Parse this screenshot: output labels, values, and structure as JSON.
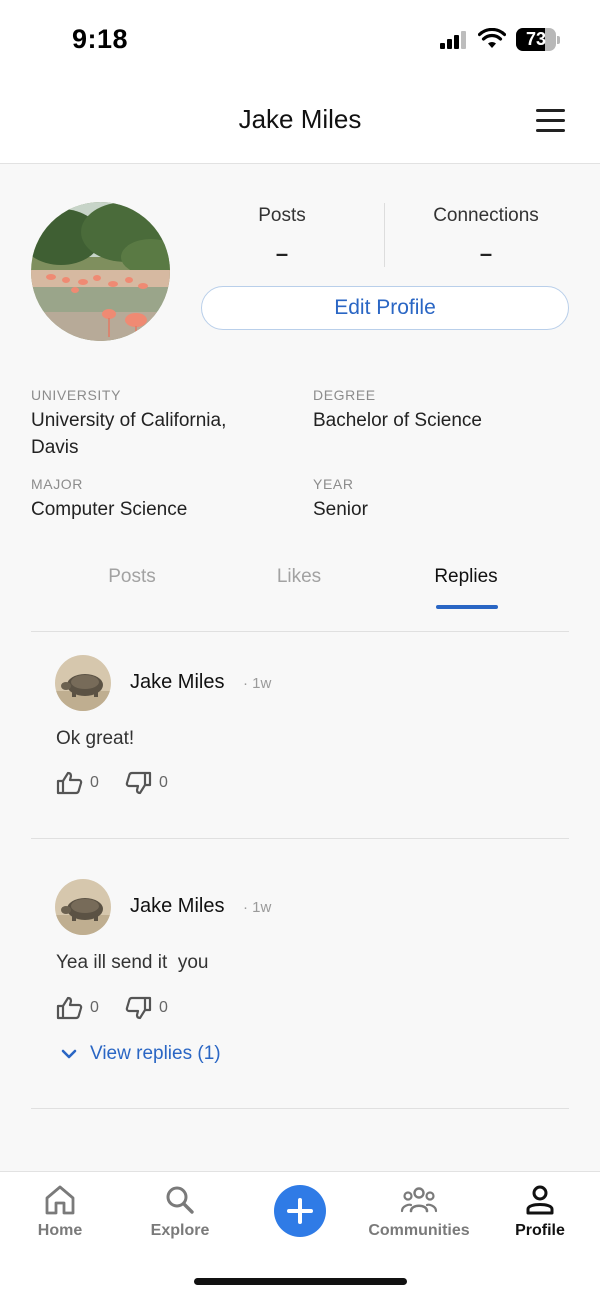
{
  "status_bar": {
    "time": "9:18",
    "battery": "73",
    "battery_level": 0.73
  },
  "header": {
    "title": "Jake Miles"
  },
  "profile": {
    "posts_label": "Posts",
    "posts_value": "–",
    "connections_label": "Connections",
    "connections_value": "–",
    "edit_button": "Edit Profile"
  },
  "info": {
    "university_label": "UNIVERSITY",
    "university_value_line1": "University of California,",
    "university_value_line2": "Davis",
    "degree_label": "DEGREE",
    "degree_value": "Bachelor of Science",
    "major_label": "MAJOR",
    "major_value": "Computer Science",
    "year_label": "YEAR",
    "year_value": "Senior"
  },
  "tabs": [
    {
      "label": "Posts",
      "active": false
    },
    {
      "label": "Likes",
      "active": false
    },
    {
      "label": "Replies",
      "active": true
    }
  ],
  "replies": [
    {
      "author": "Jake Miles",
      "time": "· 1w",
      "text": "Ok great!",
      "likes": "0",
      "dislikes": "0"
    },
    {
      "author": "Jake Miles",
      "time": "· 1w",
      "text": "Yea ill send it  you",
      "likes": "0",
      "dislikes": "0",
      "view_replies": "View replies (1)"
    }
  ],
  "nav": [
    {
      "label": "Home",
      "icon": "home-icon"
    },
    {
      "label": "Explore",
      "icon": "search-icon"
    },
    {
      "label": "",
      "icon": "plus-icon"
    },
    {
      "label": "Communities",
      "icon": "people-icon"
    },
    {
      "label": "Profile",
      "icon": "person-icon",
      "active": true
    }
  ],
  "colors": {
    "accent": "#2a66c4",
    "create_button": "#2f7be6"
  }
}
